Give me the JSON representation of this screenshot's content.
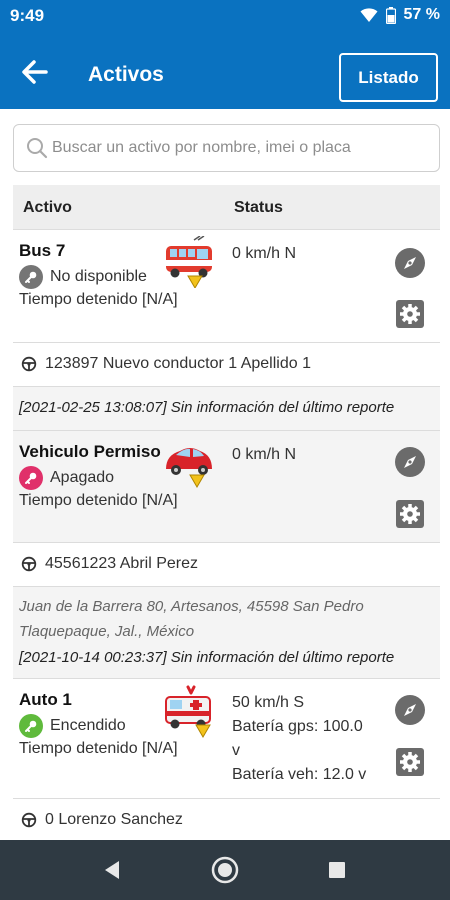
{
  "status_bar": {
    "time": "9:49",
    "battery": "57 %"
  },
  "app_bar": {
    "title": "Activos",
    "listado_label": "Listado"
  },
  "search": {
    "placeholder": "Buscar un activo por nombre, imei o placa"
  },
  "table": {
    "col_activo": "Activo",
    "col_status": "Status"
  },
  "assets": [
    {
      "name": "Bus 7",
      "state": "No disponible",
      "state_color": "#757575",
      "stopped": "Tiempo detenido [N/A]",
      "status_lines": [
        "0 km/h N"
      ],
      "icon": "bus-icon",
      "driver": "123897 Nuevo conductor 1 Apellido 1",
      "address_lines": [],
      "report": "[2021-02-25 13:08:07] Sin información del último reporte"
    },
    {
      "name": "Vehiculo Permiso",
      "state": "Apagado",
      "state_color": "#e0306a",
      "stopped": "Tiempo detenido [N/A]",
      "status_lines": [
        "0 km/h N"
      ],
      "icon": "car-icon",
      "driver": "45561223 Abril Perez",
      "address_lines": [
        "Juan de la Barrera 80, Artesanos, 45598 San Pedro",
        "Tlaquepaque, Jal., México"
      ],
      "report": "[2021-10-14 00:23:37] Sin información del último reporte"
    },
    {
      "name": "Auto 1",
      "state": "Encendido",
      "state_color": "#5fba3c",
      "stopped": "Tiempo detenido [N/A]",
      "status_lines": [
        "50 km/h S",
        "Batería gps: 100.0",
        "v",
        "Batería veh: 12.0 v"
      ],
      "icon": "ambulance-icon",
      "driver": "0 Lorenzo Sanchez",
      "address_lines": [],
      "report": ""
    }
  ]
}
